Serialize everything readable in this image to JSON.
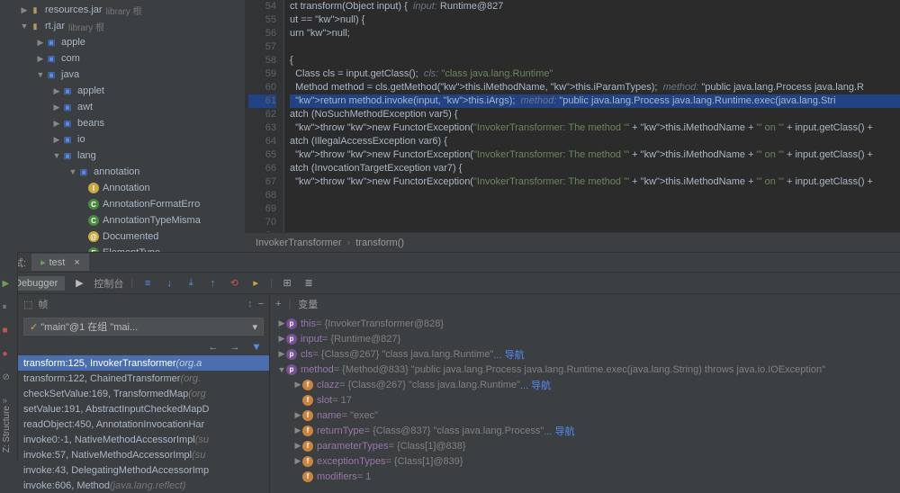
{
  "tree": {
    "resources": {
      "name": "resources.jar",
      "lib": "library 根"
    },
    "rt": {
      "name": "rt.jar",
      "lib": "library 根"
    },
    "packages": [
      "apple",
      "com",
      "java"
    ],
    "java_sub": [
      "applet",
      "awt",
      "beans",
      "io",
      "lang"
    ],
    "annotation": "annotation",
    "classes": [
      "Annotation",
      "AnnotationFormatErro",
      "AnnotationTypeMisma",
      "Documented",
      "ElementType"
    ]
  },
  "code": {
    "start": 54,
    "lines": [
      "ct transform(Object input) {  input: Runtime@827",
      "ut == null) {",
      "urn null;",
      "",
      "{",
      "  Class cls = input.getClass();  cls: \"class java.lang.Runtime\"",
      "  Method method = cls.getMethod(this.iMethodName, this.iParamTypes);  method: \"public java.lang.Process java.lang.R",
      "  return method.invoke(input, this.iArgs);  method: \"public java.lang.Process java.lang.Runtime.exec(java.lang.Stri",
      "atch (NoSuchMethodException var5) {",
      "  throw new FunctorException(\"InvokerTransformer: The method '\" + this.iMethodName + \"' on '\" + input.getClass() + ",
      "atch (IllegalAccessException var6) {",
      "  throw new FunctorException(\"InvokerTransformer: The method '\" + this.iMethodName + \"' on '\" + input.getClass() + ",
      "atch (InvocationTargetException var7) {",
      "  throw new FunctorException(\"InvokerTransformer: The method '\" + this.iMethodName + \"' on '\" + input.getClass() + ",
      "",
      "",
      "",
      "",
      ""
    ],
    "highlight": 61
  },
  "breadcrumb": {
    "class": "InvokerTransformer",
    "method": "transform()"
  },
  "debug": {
    "tab_label": "调试:",
    "tab_name": "test",
    "debugger": "Debugger",
    "console": "控制台",
    "frames_label": "帧",
    "vars_label": "变量",
    "thread": "\"main\"@1 在组 \"mai...",
    "frames": [
      {
        "t": "transform:125, InvokerTransformer",
        "p": "(org.a",
        "sel": true
      },
      {
        "t": "transform:122, ChainedTransformer",
        "p": "(org."
      },
      {
        "t": "checkSetValue:169, TransformedMap",
        "p": "(org"
      },
      {
        "t": "setValue:191, AbstractInputCheckedMapD",
        "p": ""
      },
      {
        "t": "readObject:450, AnnotationInvocationHar",
        "p": ""
      },
      {
        "t": "invoke0:-1, NativeMethodAccessorImpl",
        "p": "(su"
      },
      {
        "t": "invoke:57, NativeMethodAccessorImpl",
        "p": "(su"
      },
      {
        "t": "invoke:43, DelegatingMethodAccessorImp",
        "p": ""
      },
      {
        "t": "invoke:606, Method",
        "p": "(java.lang.reflect)"
      }
    ],
    "vars": [
      {
        "d": 0,
        "a": "▶",
        "i": "p",
        "n": "this",
        "v": "= {InvokerTransformer@828}"
      },
      {
        "d": 0,
        "a": "▶",
        "i": "p",
        "n": "input",
        "v": "= {Runtime@827}"
      },
      {
        "d": 0,
        "a": "▶",
        "i": "p",
        "n": "cls",
        "v": "= {Class@267} \"class java.lang.Runtime\"",
        "nav": "... 导航"
      },
      {
        "d": 0,
        "a": "▼",
        "i": "p",
        "n": "method",
        "v": "= {Method@833} \"public java.lang.Process java.lang.Runtime.exec(java.lang.String) throws java.io.IOException\""
      },
      {
        "d": 1,
        "a": "▶",
        "i": "f",
        "n": "clazz",
        "v": "= {Class@267} \"class java.lang.Runtime\"",
        "nav": "... 导航"
      },
      {
        "d": 1,
        "a": "",
        "i": "f",
        "n": "slot",
        "v": "= 17"
      },
      {
        "d": 1,
        "a": "▶",
        "i": "f",
        "n": "name",
        "v": "= \"exec\""
      },
      {
        "d": 1,
        "a": "▶",
        "i": "f",
        "n": "returnType",
        "v": "= {Class@837} \"class java.lang.Process\"",
        "nav": "... 导航"
      },
      {
        "d": 1,
        "a": "▶",
        "i": "f",
        "n": "parameterTypes",
        "v": "= {Class[1]@838}"
      },
      {
        "d": 1,
        "a": "▶",
        "i": "f",
        "n": "exceptionTypes",
        "v": "= {Class[1]@839}"
      },
      {
        "d": 1,
        "a": "",
        "i": "f",
        "n": "modifiers",
        "v": "= 1"
      }
    ]
  },
  "structure": "Z: Structure"
}
